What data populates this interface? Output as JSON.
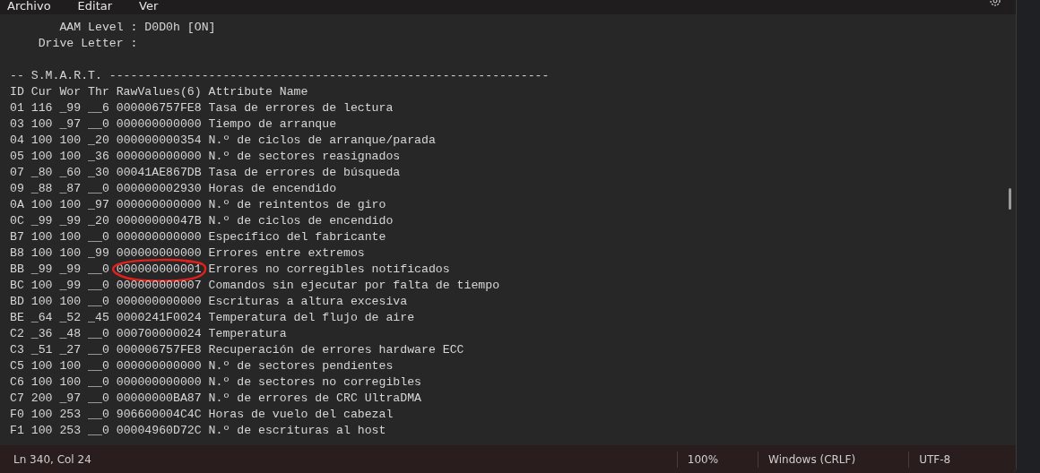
{
  "menu": [
    "Archivo",
    "Editar",
    "Ver"
  ],
  "info_lines": [
    "       AAM Level : D0D0h [ON]",
    "    Drive Letter :"
  ],
  "header_lines": [
    "-- S.M.A.R.T. --------------------------------------------------------------",
    "ID Cur Wor Thr RawValues(6) Attribute Name"
  ],
  "smart_rows": [
    {
      "id": "01",
      "cur": "116",
      "wor": "_99",
      "thr": "__6",
      "raw": "000006757FE8",
      "name": "Tasa de errores de lectura",
      "circled": false
    },
    {
      "id": "03",
      "cur": "100",
      "wor": "_97",
      "thr": "__0",
      "raw": "000000000000",
      "name": "Tiempo de arranque",
      "circled": false
    },
    {
      "id": "04",
      "cur": "100",
      "wor": "100",
      "thr": "_20",
      "raw": "000000000354",
      "name": "N.º de ciclos de arranque/parada",
      "circled": false
    },
    {
      "id": "05",
      "cur": "100",
      "wor": "100",
      "thr": "_36",
      "raw": "000000000000",
      "name": "N.º de sectores reasignados",
      "circled": false
    },
    {
      "id": "07",
      "cur": "_80",
      "wor": "_60",
      "thr": "_30",
      "raw": "00041AE867DB",
      "name": "Tasa de errores de búsqueda",
      "circled": false
    },
    {
      "id": "09",
      "cur": "_88",
      "wor": "_87",
      "thr": "__0",
      "raw": "000000002930",
      "name": "Horas de encendido",
      "circled": false
    },
    {
      "id": "0A",
      "cur": "100",
      "wor": "100",
      "thr": "_97",
      "raw": "000000000000",
      "name": "N.º de reintentos de giro",
      "circled": false
    },
    {
      "id": "0C",
      "cur": "_99",
      "wor": "_99",
      "thr": "_20",
      "raw": "00000000047B",
      "name": "N.º de ciclos de encendido",
      "circled": false
    },
    {
      "id": "B7",
      "cur": "100",
      "wor": "100",
      "thr": "__0",
      "raw": "000000000000",
      "name": "Específico del fabricante",
      "circled": false
    },
    {
      "id": "B8",
      "cur": "100",
      "wor": "100",
      "thr": "_99",
      "raw": "000000000000",
      "name": "Errores entre extremos",
      "circled": false
    },
    {
      "id": "BB",
      "cur": "_99",
      "wor": "_99",
      "thr": "__0",
      "raw": "000000000001",
      "name": "Errores no corregibles notificados",
      "circled": true
    },
    {
      "id": "BC",
      "cur": "100",
      "wor": "_99",
      "thr": "__0",
      "raw": "000000000007",
      "name": "Comandos sin ejecutar por falta de tiempo",
      "circled": false
    },
    {
      "id": "BD",
      "cur": "100",
      "wor": "100",
      "thr": "__0",
      "raw": "000000000000",
      "name": "Escrituras a altura excesiva",
      "circled": false
    },
    {
      "id": "BE",
      "cur": "_64",
      "wor": "_52",
      "thr": "_45",
      "raw": "0000241F0024",
      "name": "Temperatura del flujo de aire",
      "circled": false
    },
    {
      "id": "C2",
      "cur": "_36",
      "wor": "_48",
      "thr": "__0",
      "raw": "000700000024",
      "name": "Temperatura",
      "circled": false
    },
    {
      "id": "C3",
      "cur": "_51",
      "wor": "_27",
      "thr": "__0",
      "raw": "000006757FE8",
      "name": "Recuperación de errores hardware ECC",
      "circled": false
    },
    {
      "id": "C5",
      "cur": "100",
      "wor": "100",
      "thr": "__0",
      "raw": "000000000000",
      "name": "N.º de sectores pendientes",
      "circled": false
    },
    {
      "id": "C6",
      "cur": "100",
      "wor": "100",
      "thr": "__0",
      "raw": "000000000000",
      "name": "N.º de sectores no corregibles",
      "circled": false
    },
    {
      "id": "C7",
      "cur": "200",
      "wor": "_97",
      "thr": "__0",
      "raw": "00000000BA87",
      "name": "N.º de errores de CRC UltraDMA",
      "circled": false
    },
    {
      "id": "F0",
      "cur": "100",
      "wor": "253",
      "thr": "__0",
      "raw": "906600004C4C",
      "name": "Horas de vuelo del cabezal",
      "circled": false
    },
    {
      "id": "F1",
      "cur": "100",
      "wor": "253",
      "thr": "__0",
      "raw": "00004960D72C",
      "name": "N.º de escrituras al host",
      "circled": false
    }
  ],
  "status_bar": {
    "position": "Ln 340, Col 24",
    "zoom": "100%",
    "line_ending": "Windows (CRLF)",
    "encoding": "UTF-8"
  }
}
